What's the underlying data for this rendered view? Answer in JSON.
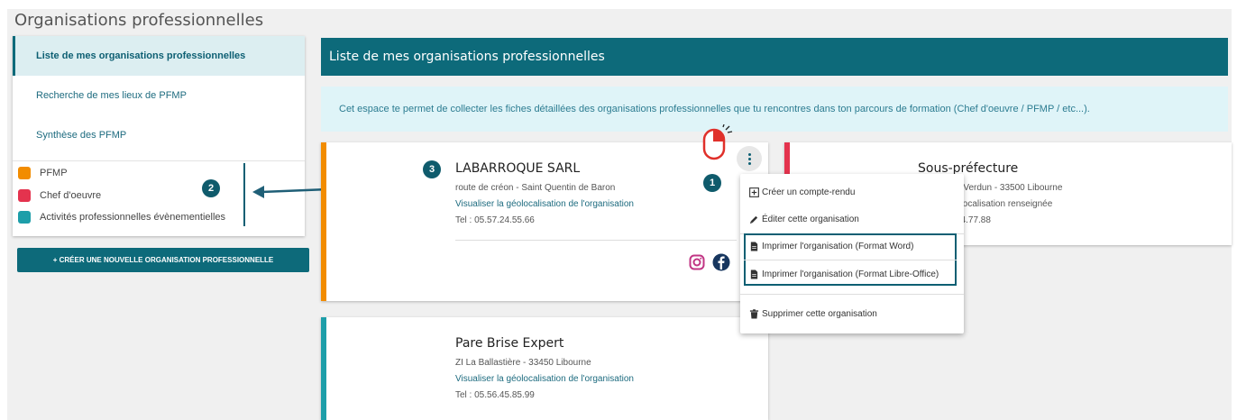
{
  "page": {
    "title": "Organisations professionnelles"
  },
  "sidebar": {
    "items": [
      {
        "label": "Liste de mes organisations professionnelles"
      },
      {
        "label": "Recherche de mes lieux de PFMP"
      },
      {
        "label": "Synthèse des PFMP"
      }
    ],
    "legend": [
      {
        "label": "PFMP",
        "color": "#f28c00"
      },
      {
        "label": "Chef d'oeuvre",
        "color": "#e4334e"
      },
      {
        "label": "Activités professionnelles évènementielles",
        "color": "#1d9ea9"
      }
    ],
    "create_button": "+ CRÉER UNE NOUVELLE ORGANISATION PROFESSIONNELLE"
  },
  "main": {
    "header": "Liste de mes organisations professionnelles",
    "info": "Cet espace te permet de collecter les fiches détaillées des organisations professionnelles que tu rencontres dans ton parcours de formation (Chef d'oeuvre / PFMP / etc...)."
  },
  "cards": [
    {
      "title": "LABARROQUE SARL",
      "address": "route de créon - Saint Quentin de Baron",
      "geo_link": "Visualiser la géolocalisation de l'organisation",
      "phone": "Tel : 05.57.24.55.66",
      "accent": "#f28c00"
    },
    {
      "title": "Sous-préfecture",
      "address": "e Verdun - 33500 Libourne",
      "geo_status": "olocalisation renseignée",
      "phone": "44.77.88",
      "accent": "#e4334e"
    },
    {
      "title": "Pare Brise Expert",
      "address": "ZI La Ballastière - 33450 Libourne",
      "geo_link": "Visualiser la géolocalisation de l'organisation",
      "phone": "Tel : 05.56.45.85.99",
      "accent": "#1d9ea9"
    }
  ],
  "menu": {
    "items": [
      {
        "label": "Créer un compte-rendu",
        "icon": "plus-square-icon"
      },
      {
        "label": "Éditer cette organisation",
        "icon": "pencil-icon"
      },
      {
        "label": "Imprimer l'organisation (Format Word)",
        "icon": "document-icon"
      },
      {
        "label": "Imprimer l'organisation (Format Libre-Office)",
        "icon": "document-icon"
      },
      {
        "label": "Supprimer cette organisation",
        "icon": "trash-icon"
      }
    ]
  },
  "annotations": {
    "step1": "1",
    "step2": "2",
    "step3": "3"
  },
  "colors": {
    "primary": "#0d6a7a",
    "info_bg": "#dff4f8",
    "annotation_red": "#e0302a"
  }
}
